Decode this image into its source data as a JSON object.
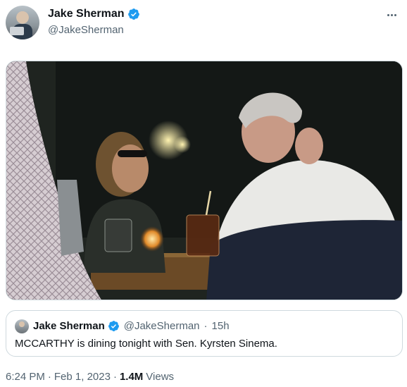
{
  "author": {
    "display_name": "Jake Sherman",
    "handle": "@JakeSherman",
    "verified": true,
    "verified_color": "#1d9bf0"
  },
  "more_menu": {
    "icon": "more-horizontal-icon"
  },
  "photo": {
    "kind": "attached-image"
  },
  "quoted_tweet": {
    "display_name": "Jake Sherman",
    "handle": "@JakeSherman",
    "separator": "·",
    "time_ago": "15h",
    "text": "MCCARTHY is dining tonight with Sen. Kyrsten Sinema."
  },
  "meta": {
    "time": "6:24 PM",
    "sep1": "·",
    "date": "Feb 1, 2023",
    "sep2": "·",
    "views_count": "1.4M",
    "views_label": "Views"
  },
  "colors": {
    "text_primary": "#0f1419",
    "text_secondary": "#536471",
    "border": "#cfd9de"
  }
}
